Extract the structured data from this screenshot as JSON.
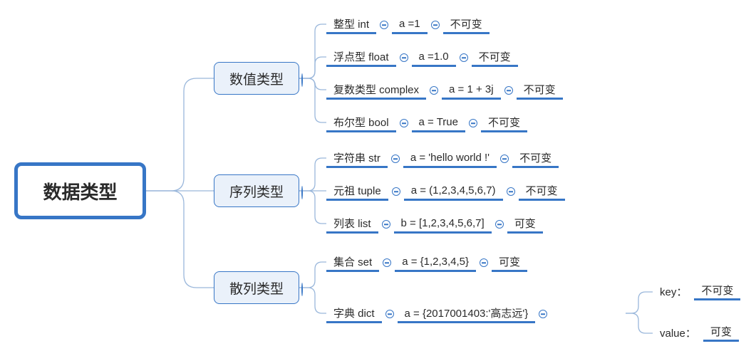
{
  "root": {
    "title": "数据类型"
  },
  "categories": [
    {
      "name": "数值类型"
    },
    {
      "name": "序列类型"
    },
    {
      "name": "散列类型"
    }
  ],
  "numeric": [
    {
      "label": "整型  int",
      "example": "a =1",
      "mutability": "不可变"
    },
    {
      "label": "浮点型  float",
      "example": "a =1.0",
      "mutability": "不可变"
    },
    {
      "label": "复数类型  complex",
      "example": "a = 1 + 3j",
      "mutability": "不可变"
    },
    {
      "label": "布尔型  bool",
      "example": "a = True",
      "mutability": "不可变"
    }
  ],
  "sequence": [
    {
      "label": "字符串  str",
      "example": "a = 'hello world !'",
      "mutability": "不可变"
    },
    {
      "label": "元祖  tuple",
      "example": "a = (1,2,3,4,5,6,7)",
      "mutability": "不可变"
    },
    {
      "label": "列表  list",
      "example": "b = [1,2,3,4,5,6,7]",
      "mutability": "可变"
    }
  ],
  "hash": [
    {
      "label": "集合  set",
      "example": "a = {1,2,3,4,5}",
      "mutability": "可变"
    },
    {
      "label": "字典  dict",
      "example": "a = {2017001403:'高志远'}",
      "mutability": null
    }
  ],
  "dict_sub": [
    {
      "k": "key：",
      "v": "不可变"
    },
    {
      "k": "value：",
      "v": "可变"
    }
  ]
}
